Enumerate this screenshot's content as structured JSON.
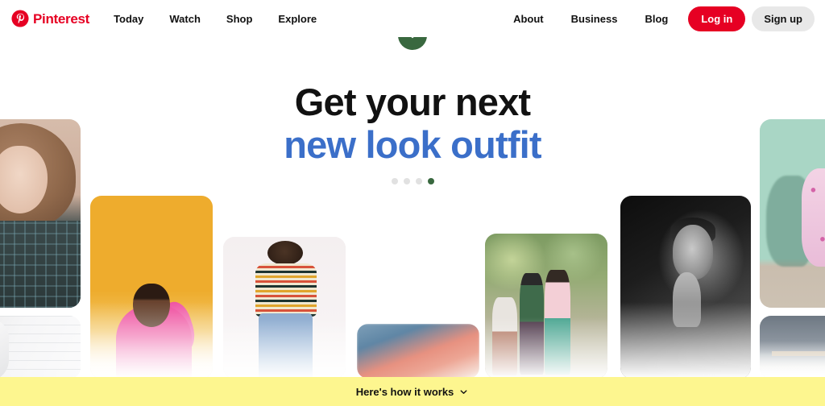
{
  "header": {
    "brand": {
      "name": "Pinterest",
      "logo_icon": "pinterest-logo-icon",
      "color": "#e60023"
    },
    "nav_left": [
      {
        "label": "Today",
        "name": "nav-link-today"
      },
      {
        "label": "Watch",
        "name": "nav-link-watch"
      },
      {
        "label": "Shop",
        "name": "nav-link-shop"
      },
      {
        "label": "Explore",
        "name": "nav-link-explore"
      }
    ],
    "nav_right": [
      {
        "label": "About",
        "name": "nav-link-about"
      },
      {
        "label": "Business",
        "name": "nav-link-business"
      },
      {
        "label": "Blog",
        "name": "nav-link-blog"
      }
    ],
    "login_label": "Log in",
    "signup_label": "Sign up"
  },
  "hero": {
    "headline_line1": "Get your next",
    "headline_line2": "new look outfit",
    "headline_color_line1": "#111111",
    "headline_color_line2": "#3b6fc9",
    "carousel": {
      "total_dots": 4,
      "active_index": 3,
      "active_color": "#39683f",
      "inactive_color": "#e1e1e1"
    }
  },
  "collage": {
    "cards": [
      {
        "name": "card-woman-plaid",
        "alt": "woman in plaid coat"
      },
      {
        "name": "card-white-shirt",
        "alt": "person in white shirt"
      },
      {
        "name": "card-orange-pink",
        "alt": "man in pink sweater on orange background"
      },
      {
        "name": "card-striped-tee",
        "alt": "woman in striped tee and jeans"
      },
      {
        "name": "card-scroll-cue",
        "alt": "blurred landscape card"
      },
      {
        "name": "card-street-style",
        "alt": "street style friends"
      },
      {
        "name": "card-bw-portrait",
        "alt": "black and white portrait of man"
      },
      {
        "name": "card-pink-dress",
        "alt": "woman in pink dress by mint wall"
      },
      {
        "name": "card-interior",
        "alt": "interior with table"
      }
    ]
  },
  "scroll_button": {
    "icon": "chevron-down-icon",
    "color": "#39683f"
  },
  "bottom_banner": {
    "label": "Here's how it works",
    "icon": "chevron-down-icon",
    "background": "#fdf68f"
  }
}
